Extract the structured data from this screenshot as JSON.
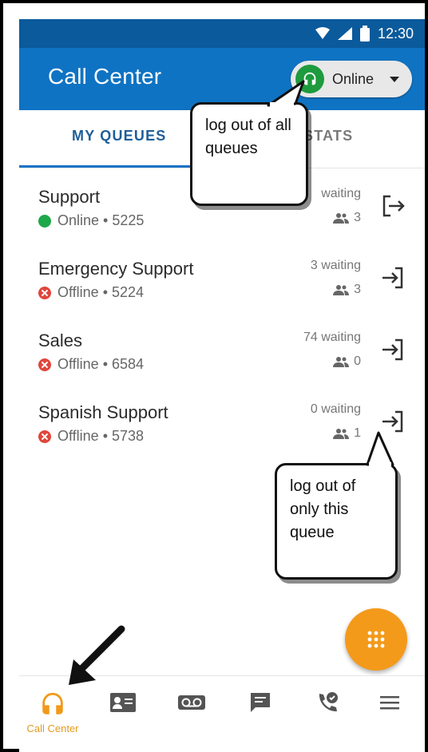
{
  "status_bar": {
    "time": "12:30"
  },
  "app_bar": {
    "title": "Call Center",
    "status_label": "Online"
  },
  "tabs": [
    {
      "label": "MY QUEUES"
    },
    {
      "label": "STATS"
    }
  ],
  "queues": [
    {
      "name": "Support",
      "status": "Online",
      "ext": "5225",
      "sub": "Online • 5225",
      "waiting": "waiting",
      "agents": "3"
    },
    {
      "name": "Emergency Support",
      "status": "Offline",
      "ext": "5224",
      "sub": "Offline • 5224",
      "waiting": "3 waiting",
      "agents": "3"
    },
    {
      "name": "Sales",
      "status": "Offline",
      "ext": "6584",
      "sub": "Offline • 6584",
      "waiting": "74 waiting",
      "agents": "0"
    },
    {
      "name": "Spanish Support",
      "status": "Offline",
      "ext": "5738",
      "sub": "Offline • 5738",
      "waiting": "0 waiting",
      "agents": "1"
    }
  ],
  "callouts": {
    "top": "log out of all queues",
    "bottom": "log out of only this queue"
  },
  "bottom_nav": [
    {
      "label": "Call Center",
      "icon": "headset-icon"
    },
    {
      "label": "",
      "icon": "contact-card-icon"
    },
    {
      "label": "",
      "icon": "voicemail-icon"
    },
    {
      "label": "",
      "icon": "message-icon"
    },
    {
      "label": "",
      "icon": "call-history-icon"
    },
    {
      "label": "",
      "icon": "menu-icon"
    }
  ],
  "colors": {
    "statusbar": "#0b5a9b",
    "appbar": "#0f73c3",
    "accent": "#f39a1b",
    "online": "#1ea84a",
    "offline": "#e0463b"
  }
}
